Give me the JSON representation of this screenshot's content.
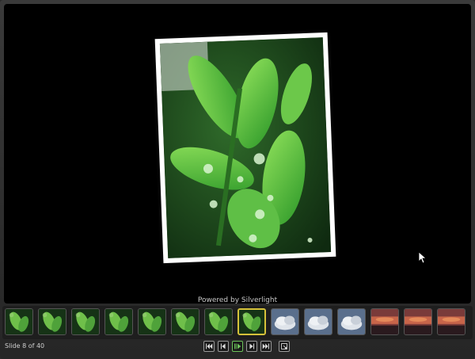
{
  "stage": {
    "powered_by": "Powered by Silverlight"
  },
  "current_photo": {
    "subject_icon": "leaf-photo"
  },
  "filmstrip": {
    "thumbnails": [
      {
        "kind": "leaf",
        "selected": false
      },
      {
        "kind": "leaf",
        "selected": false
      },
      {
        "kind": "leaf",
        "selected": false
      },
      {
        "kind": "leaf",
        "selected": false
      },
      {
        "kind": "leaf",
        "selected": false
      },
      {
        "kind": "leaf",
        "selected": false
      },
      {
        "kind": "leaf",
        "selected": false
      },
      {
        "kind": "leaf",
        "selected": true
      },
      {
        "kind": "cloud",
        "selected": false
      },
      {
        "kind": "cloud",
        "selected": false
      },
      {
        "kind": "cloud",
        "selected": false
      },
      {
        "kind": "sunset",
        "selected": false
      },
      {
        "kind": "sunset",
        "selected": false
      },
      {
        "kind": "sunset",
        "selected": false
      }
    ]
  },
  "status": {
    "slide_text": "Slide 8 of 40"
  },
  "controls": {
    "buttons": [
      "first-icon",
      "previous-icon",
      "play-pause-icon",
      "next-icon",
      "last-icon",
      "fullscreen-icon"
    ]
  },
  "colors": {
    "selected_border": "#d6c23a",
    "stage_bg": "#000000",
    "chrome_bg": "#2b2b2b"
  }
}
